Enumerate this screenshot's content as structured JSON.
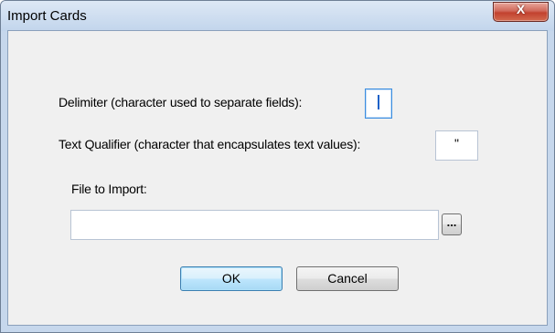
{
  "window": {
    "title": "Import Cards",
    "close_label": "X"
  },
  "form": {
    "delimiter_label": "Delimiter (character used to separate fields):",
    "delimiter_value": ",",
    "qualifier_label": "Text Qualifier (character that encapsulates text values):",
    "qualifier_value": "\"",
    "file_label": "File to Import:",
    "file_value": "",
    "browse_label": "..."
  },
  "buttons": {
    "ok": "OK",
    "cancel": "Cancel"
  }
}
